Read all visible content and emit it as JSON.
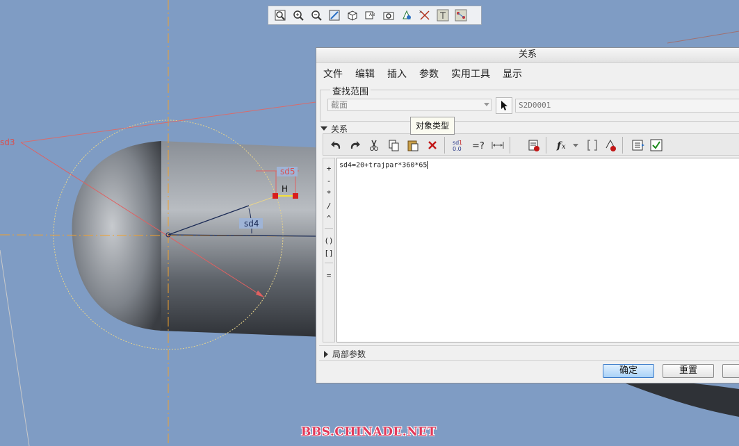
{
  "view_toolbar": {
    "icons": [
      "refit-icon",
      "zoom-in-icon",
      "zoom-out-icon",
      "repaint-icon",
      "saved-views-icon",
      "display-style-icon",
      "view-manager-icon",
      "datum-display-icon",
      "spin-center-icon",
      "annotation-display-icon",
      "sketch-display-icon"
    ]
  },
  "viewport": {
    "dimensions": [
      "sd3",
      "sd5",
      "sd4"
    ],
    "constraint_label": "H"
  },
  "dialog": {
    "title": "关系",
    "menu": [
      "文件",
      "编辑",
      "插入",
      "参数",
      "实用工具",
      "显示"
    ],
    "scope_group_label": "查找范围",
    "scope_value": "截面",
    "object_value": "S2D0001",
    "tooltip": "对象类型",
    "relations_label": "关系",
    "toolbar_icons": [
      "undo-icon",
      "redo-icon",
      "cut-icon",
      "copy-icon",
      "paste-icon",
      "delete-icon",
      "show-values-icon",
      "evaluate-icon",
      "show-dimension-icon",
      "verify-icon",
      "function-icon",
      "dropdown-icon",
      "brackets-icon",
      "sort-icon",
      "insert-parameter-icon",
      "check-icon"
    ],
    "side_operators": [
      "+",
      "-",
      "*",
      "/",
      "^",
      "()",
      "[]",
      "="
    ],
    "editor_text": "sd4=20+trajpar*360*65",
    "locals_label": "局部参数",
    "ok_label": "确定",
    "reset_label": "重置"
  },
  "watermark": "BBS.CHINADE.NET"
}
